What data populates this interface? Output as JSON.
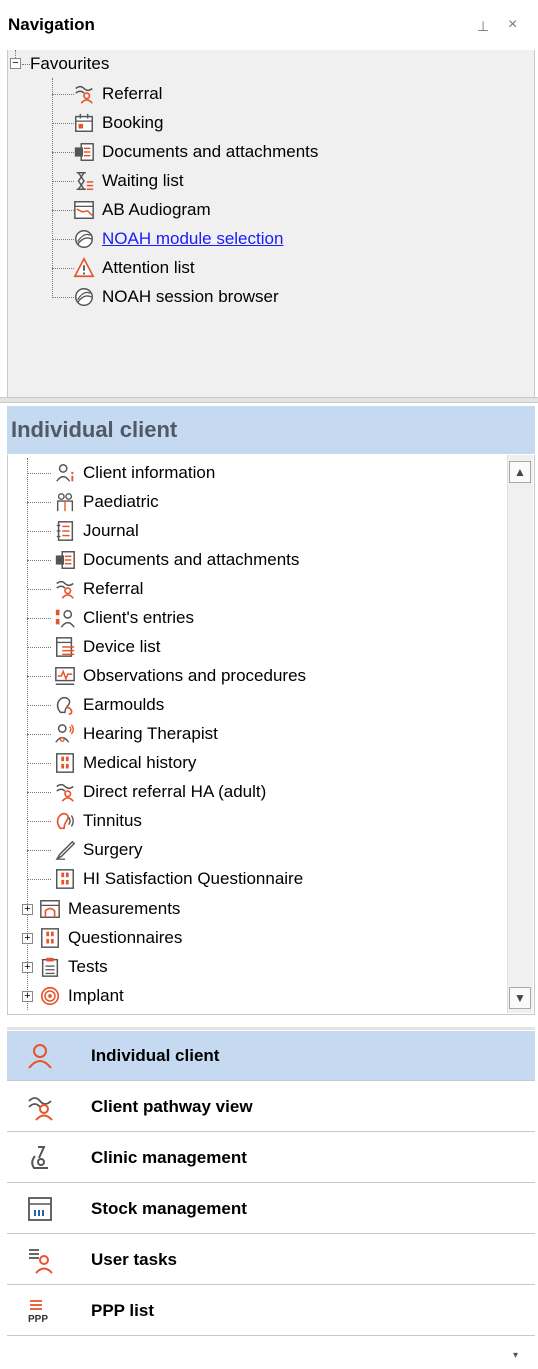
{
  "panel": {
    "title": "Navigation",
    "pin_glyph": "⊥",
    "close_glyph": "×"
  },
  "favourites": {
    "root_label": "Favourites",
    "items": [
      {
        "label": "Referral",
        "icon": "referral-icon",
        "link": false
      },
      {
        "label": "Booking",
        "icon": "booking-icon",
        "link": false
      },
      {
        "label": "Documents and attachments",
        "icon": "documents-icon",
        "link": false
      },
      {
        "label": "Waiting list",
        "icon": "waiting-list-icon",
        "link": false
      },
      {
        "label": "AB Audiogram",
        "icon": "audiogram-icon",
        "link": false
      },
      {
        "label": "NOAH module selection",
        "icon": "noah-icon",
        "link": true
      },
      {
        "label": "Attention list",
        "icon": "attention-icon",
        "link": false
      },
      {
        "label": "NOAH session browser",
        "icon": "noah-icon",
        "link": false
      }
    ]
  },
  "individual_client": {
    "title": "Individual client",
    "items": [
      {
        "label": "Client information",
        "icon": "client-info-icon",
        "expandable": false
      },
      {
        "label": "Paediatric",
        "icon": "paediatric-icon",
        "expandable": false
      },
      {
        "label": "Journal",
        "icon": "journal-icon",
        "expandable": false
      },
      {
        "label": "Documents and attachments",
        "icon": "documents-icon",
        "expandable": false
      },
      {
        "label": "Referral",
        "icon": "referral-icon",
        "expandable": false
      },
      {
        "label": "Client's entries",
        "icon": "client-entries-icon",
        "expandable": false
      },
      {
        "label": "Device list",
        "icon": "device-list-icon",
        "expandable": false
      },
      {
        "label": "Observations and procedures",
        "icon": "observations-icon",
        "expandable": false
      },
      {
        "label": "Earmoulds",
        "icon": "earmould-icon",
        "expandable": false
      },
      {
        "label": "Hearing Therapist",
        "icon": "hearing-therapist-icon",
        "expandable": false
      },
      {
        "label": "Medical history",
        "icon": "medical-history-icon",
        "expandable": false
      },
      {
        "label": "Direct referral HA (adult)",
        "icon": "referral-icon",
        "expandable": false
      },
      {
        "label": "Tinnitus",
        "icon": "tinnitus-icon",
        "expandable": false
      },
      {
        "label": "Surgery",
        "icon": "surgery-icon",
        "expandable": false
      },
      {
        "label": "HI Satisfaction Questionnaire",
        "icon": "questionnaire-icon",
        "expandable": false
      },
      {
        "label": "Measurements",
        "icon": "measurements-icon",
        "expandable": true
      },
      {
        "label": "Questionnaires",
        "icon": "questionnaire-icon",
        "expandable": true
      },
      {
        "label": "Tests",
        "icon": "tests-icon",
        "expandable": true
      },
      {
        "label": "Implant",
        "icon": "implant-icon",
        "expandable": true
      }
    ]
  },
  "nav_buttons": [
    {
      "label": "Individual client",
      "icon": "person-icon",
      "active": true
    },
    {
      "label": "Client pathway view",
      "icon": "pathway-icon",
      "active": false
    },
    {
      "label": "Clinic management",
      "icon": "microscope-icon",
      "active": false
    },
    {
      "label": "Stock management",
      "icon": "stock-icon",
      "active": false
    },
    {
      "label": "User tasks",
      "icon": "user-tasks-icon",
      "active": false
    },
    {
      "label": "PPP list",
      "icon": "ppp-list-icon",
      "active": false
    }
  ],
  "misc": {
    "tree_minus": "−",
    "tree_plus": "+",
    "scroll_up": "▲",
    "scroll_down": "▼",
    "bottom_chevron": "▾"
  },
  "colors": {
    "accent_orange": "#e8542a",
    "selection_blue": "#c5d9f1",
    "link_blue": "#1a1aff"
  }
}
